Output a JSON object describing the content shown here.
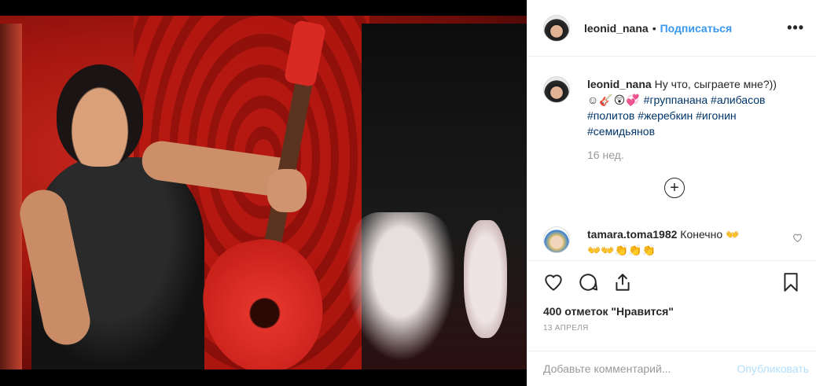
{
  "post": {
    "image_alt": "",
    "author": "leonid_nana",
    "separator": "•",
    "follow_label": "Подписаться",
    "more_label": "•••"
  },
  "caption": {
    "username": "leonid_nana",
    "text": "Ну что, сыграете мне?))",
    "emoji": "☺🎸😲💞",
    "hashtags_line1": "#группанана #алибасов",
    "hashtags_line2": "#политов #жеребкин #игонин",
    "hashtags_line3": "#семидьянов",
    "time": "16 нед."
  },
  "load_more_label": "+",
  "comment": {
    "username": "tamara.toma1982",
    "text": "Конечно",
    "emoji_line1": "👐",
    "emoji_line2": "👐👐👏👏👏"
  },
  "actions": {
    "likes": "400 отметок \"Нравится\"",
    "date": "13 апреля"
  },
  "add_comment": {
    "placeholder": "Добавьте комментарий...",
    "publish_label": "Опубликовать"
  },
  "colors": {
    "link": "#3897f0",
    "hashtag": "#003569",
    "publish_disabled": "#b2dffc",
    "muted": "#999999"
  },
  "icons": {
    "like": "heart-icon",
    "comment": "comment-icon",
    "share": "share-icon",
    "save": "bookmark-icon",
    "load_more": "plus-circle-icon",
    "comment_like": "small-heart-icon"
  }
}
